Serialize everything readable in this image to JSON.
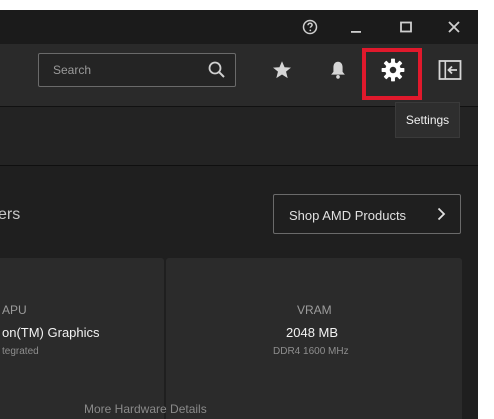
{
  "titlebar": {
    "help_icon": "help-circle-icon",
    "minimize_icon": "minimize-icon",
    "maximize_icon": "maximize-icon",
    "close_icon": "close-icon"
  },
  "header": {
    "search": {
      "placeholder": "Search",
      "icon": "search-icon"
    },
    "icons": [
      "star-icon",
      "bell-icon",
      "gear-icon",
      "sidebar-toggle-icon"
    ],
    "highlight_color": "#e0192c"
  },
  "tooltip": {
    "text": "Settings"
  },
  "main": {
    "section_title": "ers",
    "shop_button": {
      "label": "Shop AMD Products"
    },
    "cards": [
      {
        "title": "APU",
        "value": "on(TM) Graphics",
        "sub": "tegrated"
      },
      {
        "title": "VRAM",
        "value": "2048 MB",
        "sub": "DDR4 1600 MHz"
      }
    ],
    "bottom_label": "More Hardware Details"
  },
  "colors": {
    "bg": "#1f1f1f",
    "header": "#2a2a2a",
    "card": "#2b2b2b",
    "accent": "#e0192c"
  }
}
